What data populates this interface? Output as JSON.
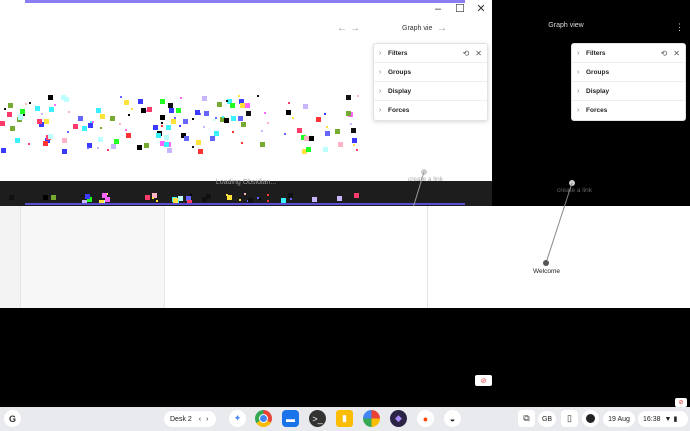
{
  "left_window": {
    "controls": {
      "minimize": "–",
      "maximize": "☐",
      "close": "✕"
    },
    "nav_back": "←",
    "nav_forward": "→",
    "graph_title": "Graph vie",
    "panel": {
      "rows": [
        "Filters",
        "Groups",
        "Display",
        "Forces"
      ]
    },
    "loading_text": "Loading Obsidian...",
    "node_label": "create a link"
  },
  "right_window": {
    "graph_title": "Graph view",
    "more_icon": "⋮",
    "nav_back": "←",
    "nav_forward": "→",
    "panel": {
      "rows": [
        "Filters",
        "Groups",
        "Display",
        "Forces"
      ]
    },
    "node_top_label": "create a link",
    "node_bottom_label": "Welcome"
  },
  "shelf": {
    "launcher": "G",
    "desk_label": "Desk 2",
    "desk_prev": "‹",
    "desk_next": "›",
    "keyboard_layout": "GB",
    "date": "19 Aug",
    "time": "16:38",
    "apps": [
      "assistant-icon",
      "chrome-icon",
      "files-icon",
      "terminal-icon",
      "keep-icon",
      "photos-icon",
      "obsidian-icon",
      "reddit-icon",
      "linux-penguin-icon"
    ]
  }
}
